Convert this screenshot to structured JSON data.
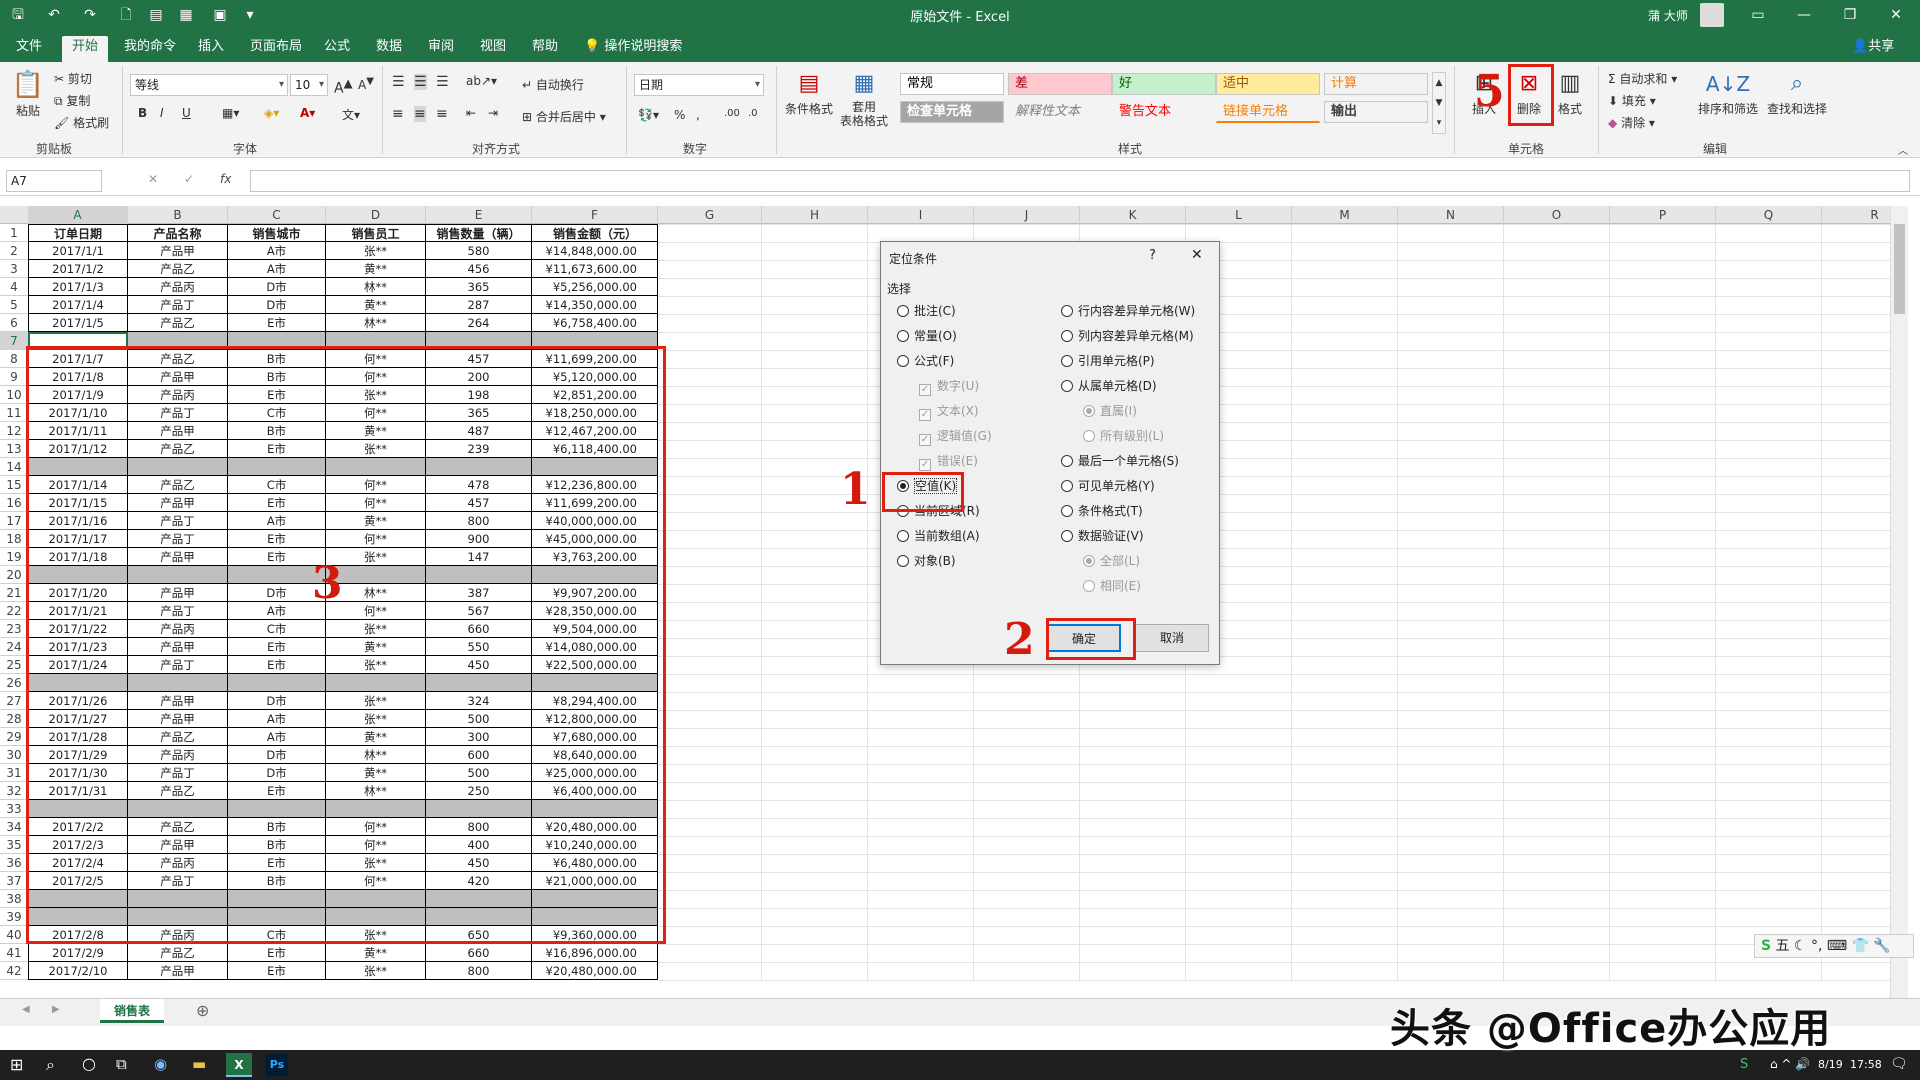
{
  "window": {
    "title": "原始文件 - Excel",
    "user": "蒲 大师"
  },
  "tabs": [
    "文件",
    "开始",
    "我的命令",
    "插入",
    "页面布局",
    "公式",
    "数据",
    "审阅",
    "视图",
    "帮助",
    "操作说明搜索"
  ],
  "active_tab": "开始",
  "share_label": "共享",
  "ribbon": {
    "clipboard": {
      "paste": "粘贴",
      "cut": "剪切",
      "copy": "复制",
      "format_painter": "格式刷",
      "label": "剪贴板"
    },
    "font": {
      "name": "等线",
      "size": "10",
      "bold": "B",
      "italic": "I",
      "underline": "U",
      "label": "字体"
    },
    "alignment": {
      "wrap": "自动换行",
      "merge": "合并后居中",
      "label": "对齐方式"
    },
    "number": {
      "format": "日期",
      "label": "数字"
    },
    "styles": {
      "conditional": "条件格式",
      "table_format": "套用\n表格格式",
      "cells": [
        {
          "text": "常规",
          "bg": "#ffffff",
          "color": "#000000"
        },
        {
          "text": "差",
          "bg": "#ffc7ce",
          "color": "#9c0006"
        },
        {
          "text": "好",
          "bg": "#c6efce",
          "color": "#006100"
        },
        {
          "text": "适中",
          "bg": "#ffeb9c",
          "color": "#9c5700"
        },
        {
          "text": "计算",
          "bg": "#f2f2f2",
          "color": "#fa7d00"
        },
        {
          "text": "检查单元格",
          "bg": "#a5a5a5",
          "color": "#ffffff"
        },
        {
          "text": "解释性文本",
          "bg": "#f3f3f3",
          "color": "#7f7f7f"
        },
        {
          "text": "警告文本",
          "bg": "#f3f3f3",
          "color": "#ff0000"
        },
        {
          "text": "链接单元格",
          "bg": "#f3f3f3",
          "color": "#fa7d00"
        },
        {
          "text": "输出",
          "bg": "#f2f2f2",
          "color": "#3f3f3f"
        }
      ],
      "label": "样式"
    },
    "cells_group": {
      "insert": "插入",
      "delete": "删除",
      "format": "格式",
      "label": "单元格"
    },
    "editing": {
      "autosum": "自动求和",
      "fill": "填充",
      "clear": "清除",
      "sort": "排序和筛选",
      "find": "查找和选择",
      "label": "编辑"
    }
  },
  "name_box": "A7",
  "fx": "fx",
  "columns": [
    "A",
    "B",
    "C",
    "D",
    "E",
    "F",
    "G",
    "H",
    "I",
    "J",
    "K",
    "L",
    "M",
    "N",
    "O",
    "P",
    "Q",
    "R"
  ],
  "table": {
    "headers": [
      "订单日期",
      "产品名称",
      "销售城市",
      "销售员工",
      "销售数量（辆）",
      "销售金额（元）"
    ],
    "rows": [
      [
        "2017/1/1",
        "产品甲",
        "A市",
        "张**",
        "580",
        "¥14,848,000.00"
      ],
      [
        "2017/1/2",
        "产品乙",
        "A市",
        "黄**",
        "456",
        "¥11,673,600.00"
      ],
      [
        "2017/1/3",
        "产品丙",
        "D市",
        "林**",
        "365",
        "¥5,256,000.00"
      ],
      [
        "2017/1/4",
        "产品丁",
        "D市",
        "黄**",
        "287",
        "¥14,350,000.00"
      ],
      [
        "2017/1/5",
        "产品乙",
        "E市",
        "林**",
        "264",
        "¥6,758,400.00"
      ],
      [],
      [
        "2017/1/7",
        "产品乙",
        "B市",
        "何**",
        "457",
        "¥11,699,200.00"
      ],
      [
        "2017/1/8",
        "产品甲",
        "B市",
        "何**",
        "200",
        "¥5,120,000.00"
      ],
      [
        "2017/1/9",
        "产品丙",
        "E市",
        "张**",
        "198",
        "¥2,851,200.00"
      ],
      [
        "2017/1/10",
        "产品丁",
        "C市",
        "何**",
        "365",
        "¥18,250,000.00"
      ],
      [
        "2017/1/11",
        "产品甲",
        "B市",
        "黄**",
        "487",
        "¥12,467,200.00"
      ],
      [
        "2017/1/12",
        "产品乙",
        "E市",
        "张**",
        "239",
        "¥6,118,400.00"
      ],
      [],
      [
        "2017/1/14",
        "产品乙",
        "C市",
        "何**",
        "478",
        "¥12,236,800.00"
      ],
      [
        "2017/1/15",
        "产品甲",
        "E市",
        "何**",
        "457",
        "¥11,699,200.00"
      ],
      [
        "2017/1/16",
        "产品丁",
        "A市",
        "黄**",
        "800",
        "¥40,000,000.00"
      ],
      [
        "2017/1/17",
        "产品丁",
        "E市",
        "何**",
        "900",
        "¥45,000,000.00"
      ],
      [
        "2017/1/18",
        "产品甲",
        "E市",
        "张**",
        "147",
        "¥3,763,200.00"
      ],
      [],
      [
        "2017/1/20",
        "产品甲",
        "D市",
        "林**",
        "387",
        "¥9,907,200.00"
      ],
      [
        "2017/1/21",
        "产品丁",
        "A市",
        "何**",
        "567",
        "¥28,350,000.00"
      ],
      [
        "2017/1/22",
        "产品丙",
        "C市",
        "张**",
        "660",
        "¥9,504,000.00"
      ],
      [
        "2017/1/23",
        "产品甲",
        "E市",
        "黄**",
        "550",
        "¥14,080,000.00"
      ],
      [
        "2017/1/24",
        "产品丁",
        "E市",
        "张**",
        "450",
        "¥22,500,000.00"
      ],
      [],
      [
        "2017/1/26",
        "产品甲",
        "D市",
        "张**",
        "324",
        "¥8,294,400.00"
      ],
      [
        "2017/1/27",
        "产品甲",
        "A市",
        "张**",
        "500",
        "¥12,800,000.00"
      ],
      [
        "2017/1/28",
        "产品乙",
        "A市",
        "黄**",
        "300",
        "¥7,680,000.00"
      ],
      [
        "2017/1/29",
        "产品丙",
        "D市",
        "林**",
        "600",
        "¥8,640,000.00"
      ],
      [
        "2017/1/30",
        "产品丁",
        "D市",
        "黄**",
        "500",
        "¥25,000,000.00"
      ],
      [
        "2017/1/31",
        "产品乙",
        "E市",
        "林**",
        "250",
        "¥6,400,000.00"
      ],
      [],
      [
        "2017/2/2",
        "产品乙",
        "B市",
        "何**",
        "800",
        "¥20,480,000.00"
      ],
      [
        "2017/2/3",
        "产品甲",
        "B市",
        "何**",
        "400",
        "¥10,240,000.00"
      ],
      [
        "2017/2/4",
        "产品丙",
        "E市",
        "张**",
        "450",
        "¥6,480,000.00"
      ],
      [
        "2017/2/5",
        "产品丁",
        "B市",
        "何**",
        "420",
        "¥21,000,000.00"
      ],
      [],
      [],
      [
        "2017/2/8",
        "产品丙",
        "C市",
        "张**",
        "650",
        "¥9,360,000.00"
      ],
      [
        "2017/2/9",
        "产品乙",
        "E市",
        "黄**",
        "660",
        "¥16,896,000.00"
      ],
      [
        "2017/2/10",
        "产品甲",
        "E市",
        "张**",
        "800",
        "¥20,480,000.00"
      ]
    ]
  },
  "sheet_tab": "销售表",
  "dialog": {
    "title": "定位条件",
    "help": "?",
    "section": "选择",
    "left_options": [
      {
        "label": "批注(C)",
        "type": "radio",
        "checked": false,
        "disabled": false
      },
      {
        "label": "常量(O)",
        "type": "radio",
        "checked": false,
        "disabled": false
      },
      {
        "label": "公式(F)",
        "type": "radio",
        "checked": false,
        "disabled": false
      },
      {
        "label": "数字(U)",
        "type": "check",
        "checked": true,
        "disabled": true
      },
      {
        "label": "文本(X)",
        "type": "check",
        "checked": true,
        "disabled": true
      },
      {
        "label": "逻辑值(G)",
        "type": "check",
        "checked": true,
        "disabled": true
      },
      {
        "label": "错误(E)",
        "type": "check",
        "checked": true,
        "disabled": true
      },
      {
        "label": "空值(K)",
        "type": "radio",
        "checked": true,
        "disabled": false
      },
      {
        "label": "当前区域(R)",
        "type": "radio",
        "checked": false,
        "disabled": false
      },
      {
        "label": "当前数组(A)",
        "type": "radio",
        "checked": false,
        "disabled": false
      },
      {
        "label": "对象(B)",
        "type": "radio",
        "checked": false,
        "disabled": false
      }
    ],
    "right_options": [
      {
        "label": "行内容差异单元格(W)",
        "type": "radio",
        "checked": false,
        "disabled": false
      },
      {
        "label": "列内容差异单元格(M)",
        "type": "radio",
        "checked": false,
        "disabled": false
      },
      {
        "label": "引用单元格(P)",
        "type": "radio",
        "checked": false,
        "disabled": false
      },
      {
        "label": "从属单元格(D)",
        "type": "radio",
        "checked": false,
        "disabled": false
      },
      {
        "label": "直属(I)",
        "type": "radio",
        "checked": true,
        "disabled": true
      },
      {
        "label": "所有级别(L)",
        "type": "radio",
        "checked": false,
        "disabled": true
      },
      {
        "label": "最后一个单元格(S)",
        "type": "radio",
        "checked": false,
        "disabled": false
      },
      {
        "label": "可见单元格(Y)",
        "type": "radio",
        "checked": false,
        "disabled": false
      },
      {
        "label": "条件格式(T)",
        "type": "radio",
        "checked": false,
        "disabled": false
      },
      {
        "label": "数据验证(V)",
        "type": "radio",
        "checked": false,
        "disabled": false
      },
      {
        "label": "全部(L)",
        "type": "radio",
        "checked": true,
        "disabled": true
      },
      {
        "label": "相同(E)",
        "type": "radio",
        "checked": false,
        "disabled": true
      }
    ],
    "ok": "确定",
    "cancel": "取消"
  },
  "annotations": [
    "1",
    "2",
    "3",
    "5"
  ],
  "watermark": "头条 @Office办公应用",
  "taskbar": {
    "time": "17:58",
    "date": "8/19"
  },
  "colors": {
    "excel_green": "#217346",
    "annotation_red": "#e02010"
  }
}
